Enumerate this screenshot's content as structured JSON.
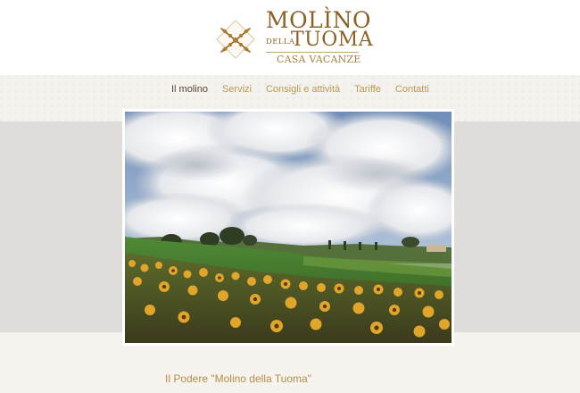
{
  "logo": {
    "line1": "MOLÌNO",
    "della": "DELLA",
    "line2": "TUOMA",
    "subtitle": "CASA VACANZE",
    "emblem_icon": "sheaf-emblem-icon",
    "color": "#8a6226"
  },
  "nav": {
    "items": [
      {
        "label": "Il molino",
        "active": true
      },
      {
        "label": "Servizi",
        "active": false
      },
      {
        "label": "Consigli e attività",
        "active": false
      },
      {
        "label": "Tariffe",
        "active": false
      },
      {
        "label": "Contatti",
        "active": false
      }
    ],
    "active_color": "#5a4a33",
    "link_color": "#b89a52"
  },
  "hero": {
    "image_icon": "sunflower-field-photo"
  },
  "content": {
    "section_title": "Il Podere \"Molino della Tuoma\""
  }
}
